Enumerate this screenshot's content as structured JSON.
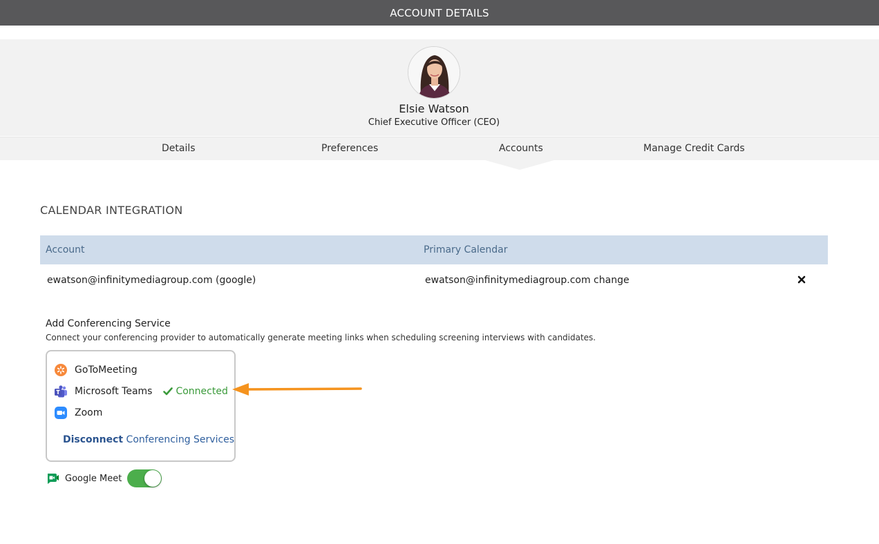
{
  "header": {
    "title": "ACCOUNT DETAILS"
  },
  "profile": {
    "name": "Elsie Watson",
    "role": "Chief Executive Officer (CEO)"
  },
  "tabs": [
    {
      "label": "Details"
    },
    {
      "label": "Preferences"
    },
    {
      "label": "Accounts",
      "active": true
    },
    {
      "label": "Manage Credit Cards"
    }
  ],
  "calendar": {
    "section_title": "CALENDAR INTEGRATION",
    "columns": [
      "Account",
      "Primary Calendar"
    ],
    "rows": [
      {
        "account": "ewatson@infinitymediagroup.com (google)",
        "primary_calendar": "ewatson@infinitymediagroup.com change"
      }
    ]
  },
  "conferencing": {
    "title": "Add Conferencing Service",
    "description": "Connect your conferencing provider to automatically generate meeting links when scheduling screening interviews with candidates.",
    "services": [
      {
        "label": "GoToMeeting",
        "icon": "gotomeeting-icon"
      },
      {
        "label": "Microsoft Teams",
        "icon": "microsoft-teams-icon",
        "status": "Connected"
      },
      {
        "label": "Zoom",
        "icon": "zoom-icon"
      }
    ],
    "disconnect_bold": "Disconnect",
    "disconnect_rest": " Conferencing Services",
    "google_meet": {
      "label": "Google Meet",
      "enabled": true
    }
  },
  "colors": {
    "topbar": "#58585a",
    "table_header": "#cfdceb",
    "connected": "#3a9a3a",
    "toggle_on": "#4cae4c",
    "arrow": "#f5931e"
  }
}
